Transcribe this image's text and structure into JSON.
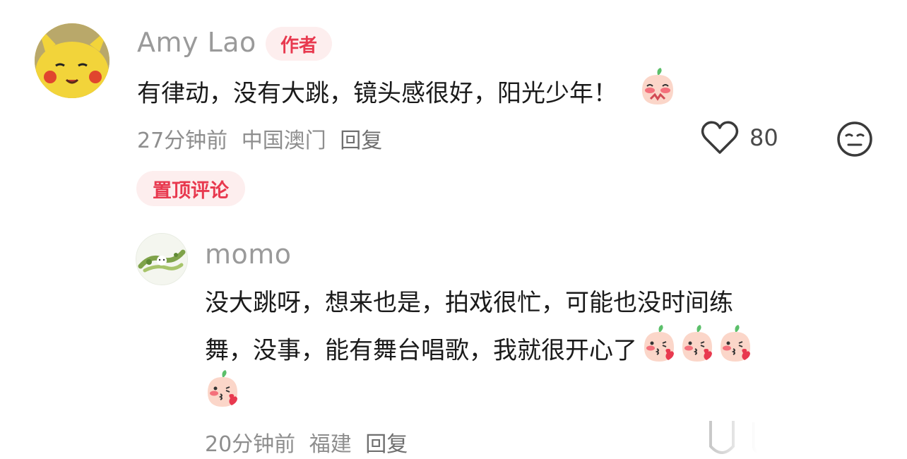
{
  "main_comment": {
    "author": "Amy Lao",
    "author_badge": "作者",
    "text": "有律动，没有大跳，镜头感很好，阳光少年！",
    "time": "27分钟前",
    "location": "中国澳门",
    "reply_label": "回复",
    "like_count": "80",
    "pinned_label": "置顶评论",
    "icons": [
      "heart-outline-icon",
      "neutral-face-icon",
      "blushing-peach-emoji"
    ]
  },
  "reply_comment": {
    "author": "momo",
    "text_line1": "没大跳呀，想来也是，拍戏很忙，可能也没时间练",
    "text_line2": "舞，没事，能有舞台唱歌，我就很开心了",
    "time": "20分钟前",
    "location": "福建",
    "reply_label": "回复",
    "emoji_count": 4,
    "icons": [
      "kissing-peach-emoji"
    ]
  },
  "colors": {
    "accent_red": "#e8394f",
    "badge_bg": "#fdeeee",
    "meta_gray": "#8e8e8e",
    "name_gray": "#9a9a9a"
  }
}
